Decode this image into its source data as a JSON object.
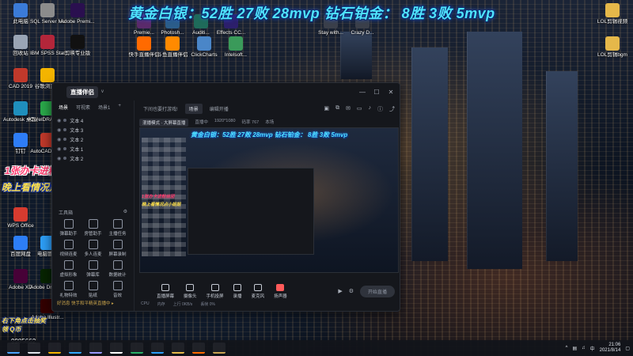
{
  "overlay": {
    "stream_title": "黄金白银：52胜 27败 28mvp 钻石铂金： 8胜 3败 5mvp",
    "promo_line1": "1张办卡进粉丝团",
    "promo_line2": "晚上看情况点小姐姐",
    "bottom_promo1": "右下角点击抽奖",
    "bottom_promo2": "领 Q币",
    "viewer_count": "9985662"
  },
  "desktop_icons": [
    {
      "label": "此电脑",
      "icon": "computer-icon",
      "color": "#3b7bd8"
    },
    {
      "label": "SQL Server Managem...",
      "icon": "sql-server-icon",
      "color": "#8c8c8c"
    },
    {
      "label": "Adobe Premi...",
      "icon": "premiere-icon",
      "color": "#2a0f4f"
    },
    {
      "label": "回收站",
      "icon": "recycle-bin-icon",
      "color": "#9aa5b5"
    },
    {
      "label": "IBM SPSS Statistics 21",
      "icon": "spss-icon",
      "color": "#b3263a"
    },
    {
      "label": "剪映专业版",
      "icon": "capcut-icon",
      "color": "#111111"
    },
    {
      "label": "CAD 2019",
      "icon": "cad-icon",
      "color": "#c0392b"
    },
    {
      "label": "谷歌浏览器",
      "icon": "chrome-icon",
      "color": "#f4b400"
    },
    {
      "label": "Autodesk 桌面应用程序",
      "icon": "autodesk-icon",
      "color": "#1f8fbd"
    },
    {
      "label": "CorelDRAW 2020 (6...",
      "icon": "coreldraw-icon",
      "color": "#2aa84a"
    },
    {
      "label": "钉钉",
      "icon": "dingtalk-icon",
      "color": "#2e7df6"
    },
    {
      "label": "AutoCAD 2019",
      "icon": "autocad-icon",
      "color": "#c0392b"
    },
    {
      "label": "WPS Office",
      "icon": "wps-icon",
      "color": "#d63b2f"
    },
    {
      "label": "百度网盘",
      "icon": "baidu-netdisk-icon",
      "color": "#2d7ef7"
    },
    {
      "label": "电脑管家",
      "icon": "pc-manager-icon",
      "color": "#2d9ef7"
    },
    {
      "label": "Adobe XD",
      "icon": "adobe-xd-icon",
      "color": "#470137"
    },
    {
      "label": "Adobe Dreamw...",
      "icon": "dreamweaver-icon",
      "color": "#072401"
    },
    {
      "label": "Adobe Illustr...",
      "icon": "illustrator-icon",
      "color": "#300"
    },
    {
      "label": "Premie...",
      "icon": "premiere-file-icon",
      "color": "#5a2a6b"
    },
    {
      "label": "Photosh...",
      "icon": "photoshop-file-icon",
      "color": "#2b5d8a"
    },
    {
      "label": "Auditi...",
      "icon": "audition-file-icon",
      "color": "#1f6b5a"
    },
    {
      "label": "Effects CC...",
      "icon": "after-effects-file-icon",
      "color": "#2c1f6b"
    },
    {
      "label": "Stay with...",
      "icon": "video-file-icon",
      "color": "#3a3f4a"
    },
    {
      "label": "Crazy D...",
      "icon": "video-file-icon",
      "color": "#3a3f4a"
    },
    {
      "label": "快手直播伴侣",
      "icon": "kuaishou-companion-icon",
      "color": "#ff6a00"
    },
    {
      "label": "斗鱼直播伴侣",
      "icon": "douyu-companion-icon",
      "color": "#ff8a00"
    },
    {
      "label": "ClickCharts",
      "icon": "clickcharts-icon",
      "color": "#4a86c8"
    },
    {
      "label": "Intelsoft...",
      "icon": "intelsoft-icon",
      "color": "#3a9a5a"
    },
    {
      "label": "LOL剪辑视频",
      "icon": "folder-icon",
      "color": "#e5b84a"
    },
    {
      "label": "LOL剪辑bgm",
      "icon": "folder-icon",
      "color": "#e5b84a"
    }
  ],
  "app": {
    "logo": "直播伴侣",
    "version": "v",
    "sidebar_tabs": [
      "场景",
      "可视素",
      "场景1"
    ],
    "scenes": [
      "文本 4",
      "文本 3",
      "文本 2",
      "文本 1",
      "文本 2"
    ],
    "tools_label": "工具箱",
    "tools": [
      "弹幕助手",
      "房管助手",
      "主播任务",
      "视频连麦",
      "多人连麦",
      "屏幕录制",
      "虚拟形象",
      "弹幕库",
      "数据统计",
      "礼物特效",
      "贴纸",
      "音效"
    ],
    "sidebar_footer": "好消息 快手和平精英直播中 ▸",
    "main_tabs": {
      "live_tab": "下间也要打游戏!",
      "chip1": "场景",
      "chip2": "编辑开播"
    },
    "info_bar": {
      "mode": "混播模式 · 大屏幕直播",
      "fps": "直播中",
      "resolution": "1920*1080",
      "bitrate": "码率 767",
      "extra": "本场"
    },
    "preview_title": "黄金白银：52胜 27败 28mvp 钻石铂金： 8胜 3败 5mvp",
    "preview_promo1": "1张办卡进粉丝团",
    "preview_promo2": "晚上看情况点小姐姐",
    "bottom_bar": [
      {
        "label": "直播屏幕",
        "icon": "screen-share-icon"
      },
      {
        "label": "摄像头",
        "icon": "camera-icon"
      },
      {
        "label": "手机投屏",
        "icon": "phone-cast-icon"
      },
      {
        "label": "录播",
        "icon": "record-icon"
      },
      {
        "label": "麦克风",
        "icon": "microphone-icon"
      },
      {
        "label": "扬声器",
        "icon": "speaker-icon"
      }
    ],
    "start_live": "开始直播",
    "status": [
      "CPU",
      "内存",
      "上行 0KB/s",
      "丢帧 0%"
    ]
  },
  "taskbar": {
    "time": "21:06",
    "date": "2021/8/14",
    "tray": "中",
    "apps": [
      {
        "icon": "windows-start-icon",
        "color": "#4aa3ff"
      },
      {
        "icon": "search-icon",
        "color": "#dfe3ea"
      },
      {
        "icon": "chrome-taskbar-icon",
        "color": "#f4b400"
      },
      {
        "icon": "photoshop-taskbar-icon",
        "color": "#31a8ff"
      },
      {
        "icon": "premiere-taskbar-icon",
        "color": "#9999ff"
      },
      {
        "icon": "capcut-taskbar-icon",
        "color": "#ffffff"
      },
      {
        "icon": "wechat-taskbar-icon",
        "color": "#2aae67"
      },
      {
        "icon": "video-taskbar-icon",
        "color": "#2d9ef7"
      },
      {
        "icon": "explorer-taskbar-icon",
        "color": "#e5b84a"
      },
      {
        "icon": "kuaishou-taskbar-icon",
        "color": "#ff6a00"
      },
      {
        "icon": "game-taskbar-icon",
        "color": "#c8a252"
      }
    ]
  },
  "colors": {
    "title_cyan": "#4fe3ff",
    "promo_pink": "#ff3a6e",
    "promo_yellow": "#ffe14a",
    "app_bg": "#15171c"
  }
}
